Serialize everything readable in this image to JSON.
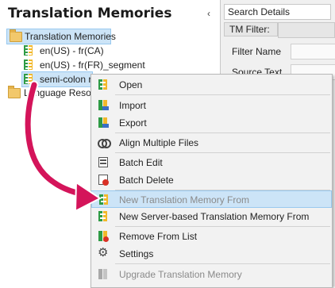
{
  "left_panel": {
    "title": "Translation Memories",
    "collapse_glyph": "‹"
  },
  "tree": {
    "root": "Translation Memories",
    "items": [
      "en(US) - fr(CA)",
      "en(US) - fr(FR)_segment",
      "semi-colon rule"
    ],
    "second_root": "Language Resources"
  },
  "right_panel": {
    "title": "Search Details",
    "tm_filter": "TM Filter:",
    "filter_name": "Filter Name",
    "source_text": "Source Text"
  },
  "context_menu": {
    "items": [
      {
        "label": "Open",
        "icon": "tm-open-icon",
        "disabled": false,
        "highlighted": false
      },
      {
        "label": "Import",
        "icon": "tm-import-icon",
        "disabled": false,
        "highlighted": false
      },
      {
        "label": "Export",
        "icon": "tm-export-icon",
        "disabled": false,
        "highlighted": false
      },
      {
        "label": "Align Multiple Files",
        "icon": "align-rings-icon",
        "disabled": false,
        "highlighted": false
      },
      {
        "label": "Batch Edit",
        "icon": "batch-edit-icon",
        "disabled": false,
        "highlighted": false
      },
      {
        "label": "Batch Delete",
        "icon": "batch-delete-icon",
        "disabled": false,
        "highlighted": false
      },
      {
        "label": "New Translation Memory From",
        "icon": "new-tm-from-icon",
        "disabled": true,
        "highlighted": true
      },
      {
        "label": "New Server-based Translation Memory From",
        "icon": "new-server-tm-icon",
        "disabled": false,
        "highlighted": false
      },
      {
        "label": "Remove From List",
        "icon": "remove-tm-icon",
        "disabled": false,
        "highlighted": false
      },
      {
        "label": "Settings",
        "icon": "gear-icon",
        "disabled": false,
        "highlighted": false
      },
      {
        "label": "Upgrade Translation Memory",
        "icon": "upgrade-tm-icon",
        "disabled": true,
        "highlighted": false
      }
    ]
  },
  "colors": {
    "highlight": "#cce4f7",
    "annotation_arrow": "#d4145a",
    "tm_green": "#2e9b45",
    "tm_yellow": "#f2b82a"
  }
}
